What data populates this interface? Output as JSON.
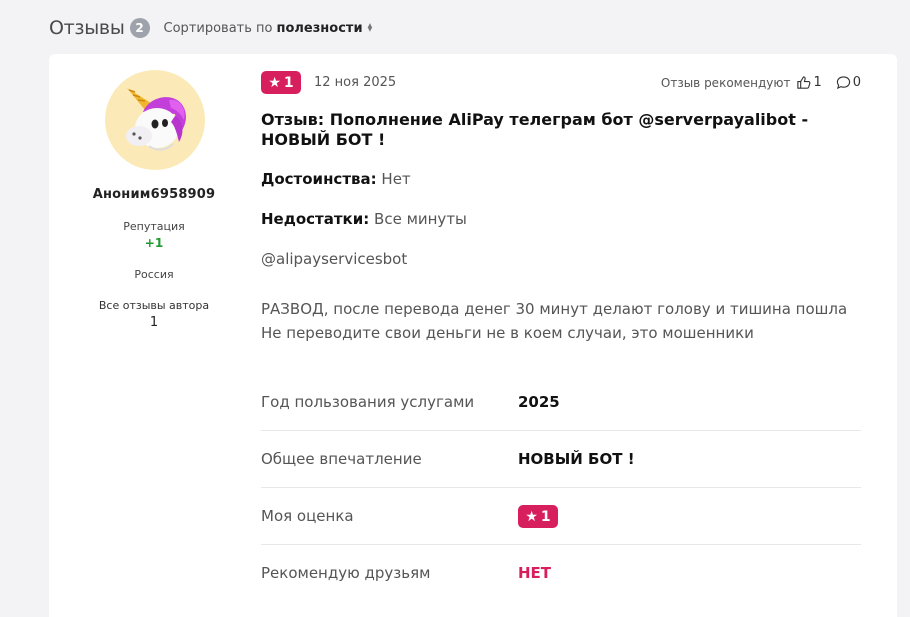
{
  "header": {
    "title": "Отзывы",
    "count": "2",
    "sort_prefix": "Сортировать по",
    "sort_value": "полезности"
  },
  "author": {
    "name": "Аноним6958909",
    "reputation_label": "Репутация",
    "reputation_value": "+1",
    "country": "Россия",
    "all_reviews_label": "Все отзывы автора",
    "all_reviews_count": "1",
    "avatar_icon": "unicorn-avatar"
  },
  "review": {
    "rating": "1",
    "date": "12 ноя 2025",
    "recommend_label": "Отзыв рекомендуют",
    "likes": "1",
    "comments": "0",
    "title": "Отзыв: Пополнение AliPay телеграм бот @serverpayalibot - НОВЫЙ БОТ !",
    "pros_label": "Достоинства:",
    "pros_value": "Нет",
    "cons_label": "Недостатки:",
    "cons_value": "Все минуты",
    "handle": "@alipayservicesbot",
    "body_line1": "РАЗВОД, после перевода денег 30 минут делают голову и тишина пошла",
    "body_line2": "Не переводите свои деньги не в коем случаи, это мошенники"
  },
  "details": [
    {
      "label": "Год пользования услугами",
      "value": "2025"
    },
    {
      "label": "Общее впечатление",
      "value": "НОВЫЙ БОТ !"
    },
    {
      "label": "Моя оценка",
      "value": "1"
    },
    {
      "label": "Рекомендую друзьям",
      "value": "НЕТ"
    }
  ],
  "colors": {
    "accent": "#d81f5e",
    "reputation": "#1e9b2f",
    "background": "#f3f3f5"
  }
}
